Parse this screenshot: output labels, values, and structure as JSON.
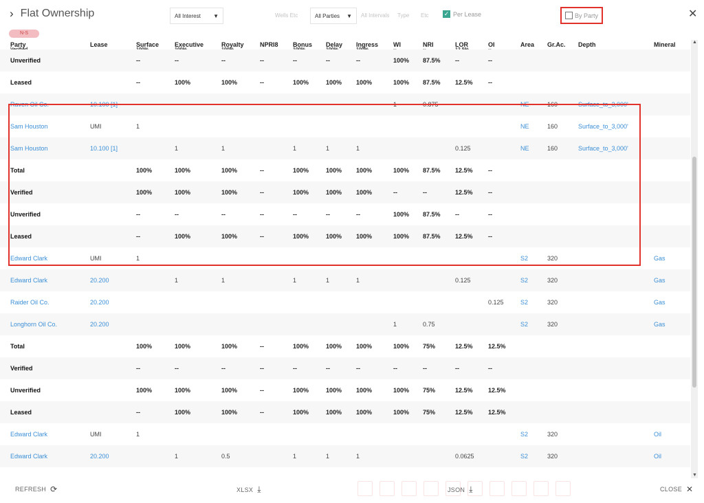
{
  "header": {
    "title": "Flat Ownership",
    "interest_select": "All Interest",
    "parties_select": "All Parties",
    "faded_filter_1": "Wells Etc",
    "faded_filter_2": "All Intervals",
    "faded_filter_3": "Type",
    "faded_filter_4": "Etc",
    "per_lease_label": "Per Lease",
    "per_lease_checked": true,
    "by_party_label": "By Party",
    "by_party_checked": false,
    "close_icon": "close-icon",
    "badge": "N-S"
  },
  "columns": [
    "Party",
    "Lease",
    "Surface",
    "Executive",
    "Royalty",
    "NPRI8",
    "Bonus",
    "Delay",
    "Ingress",
    "WI",
    "NRI",
    "LOR",
    "OI",
    "Area",
    "Gr.Ac.",
    "Depth",
    "Mineral"
  ],
  "partial_row": {
    "party": "Verified",
    "surface": "100%",
    "executive": "100%",
    "royalty": "100%",
    "bonus": "100%",
    "delay": "100%",
    "ingress": "100%",
    "wi": "--",
    "nri": "--",
    "lor": "12.5%",
    "oi": "--"
  },
  "rows": [
    {
      "type": "summary",
      "party": "Unverified",
      "surface": "--",
      "executive": "--",
      "royalty": "--",
      "npri8": "--",
      "bonus": "--",
      "delay": "--",
      "ingress": "--",
      "wi": "100%",
      "nri": "87.5%",
      "lor": "--",
      "oi": "--"
    },
    {
      "type": "summary",
      "party": "Leased",
      "surface": "--",
      "executive": "100%",
      "royalty": "100%",
      "npri8": "--",
      "bonus": "100%",
      "delay": "100%",
      "ingress": "100%",
      "wi": "100%",
      "nri": "87.5%",
      "lor": "12.5%",
      "oi": "--"
    },
    {
      "type": "party",
      "party": "Raven Oil Co.",
      "lease": "10.100 [1]",
      "lease_link": true,
      "wi": "1",
      "nri": "0.875",
      "area": "NE",
      "grac": "160",
      "depth": "Surface_to_3,000'"
    },
    {
      "type": "party",
      "party": "Sam Houston",
      "lease": "UMI",
      "surface": "1",
      "area": "NE",
      "grac": "160",
      "depth": "Surface_to_3,000'"
    },
    {
      "type": "party",
      "party": "Sam Houston",
      "lease": "10.100 [1]",
      "lease_link": true,
      "executive": "1",
      "royalty": "1",
      "bonus": "1",
      "delay": "1",
      "ingress": "1",
      "lor": "0.125",
      "area": "NE",
      "grac": "160",
      "depth": "Surface_to_3,000'"
    },
    {
      "type": "summary",
      "party": "Total",
      "surface": "100%",
      "executive": "100%",
      "royalty": "100%",
      "npri8": "--",
      "bonus": "100%",
      "delay": "100%",
      "ingress": "100%",
      "wi": "100%",
      "nri": "87.5%",
      "lor": "12.5%",
      "oi": "--"
    },
    {
      "type": "summary",
      "party": "Verified",
      "surface": "100%",
      "executive": "100%",
      "royalty": "100%",
      "npri8": "--",
      "bonus": "100%",
      "delay": "100%",
      "ingress": "100%",
      "wi": "--",
      "nri": "--",
      "lor": "12.5%",
      "oi": "--"
    },
    {
      "type": "summary",
      "party": "Unverified",
      "surface": "--",
      "executive": "--",
      "royalty": "--",
      "npri8": "--",
      "bonus": "--",
      "delay": "--",
      "ingress": "--",
      "wi": "100%",
      "nri": "87.5%",
      "lor": "--",
      "oi": "--"
    },
    {
      "type": "summary",
      "party": "Leased",
      "surface": "--",
      "executive": "100%",
      "royalty": "100%",
      "npri8": "--",
      "bonus": "100%",
      "delay": "100%",
      "ingress": "100%",
      "wi": "100%",
      "nri": "87.5%",
      "lor": "12.5%",
      "oi": "--"
    },
    {
      "type": "party",
      "party": "Edward Clark",
      "lease": "UMI",
      "surface": "1",
      "area": "S2",
      "grac": "320",
      "mineral": "Gas"
    },
    {
      "type": "party",
      "party": "Edward Clark",
      "lease": "20.200",
      "lease_link": true,
      "executive": "1",
      "royalty": "1",
      "bonus": "1",
      "delay": "1",
      "ingress": "1",
      "lor": "0.125",
      "area": "S2",
      "grac": "320",
      "mineral": "Gas"
    },
    {
      "type": "party",
      "party": "Raider Oil Co.",
      "lease": "20.200",
      "lease_link": true,
      "oi": "0.125",
      "area": "S2",
      "grac": "320",
      "mineral": "Gas"
    },
    {
      "type": "party",
      "party": "Longhorn Oil Co.",
      "lease": "20.200",
      "lease_link": true,
      "wi": "1",
      "nri": "0.75",
      "area": "S2",
      "grac": "320",
      "mineral": "Gas"
    },
    {
      "type": "summary",
      "party": "Total",
      "surface": "100%",
      "executive": "100%",
      "royalty": "100%",
      "npri8": "--",
      "bonus": "100%",
      "delay": "100%",
      "ingress": "100%",
      "wi": "100%",
      "nri": "75%",
      "lor": "12.5%",
      "oi": "12.5%"
    },
    {
      "type": "summary",
      "party": "Verified",
      "surface": "--",
      "executive": "--",
      "royalty": "--",
      "npri8": "--",
      "bonus": "--",
      "delay": "--",
      "ingress": "--",
      "wi": "--",
      "nri": "--",
      "lor": "--",
      "oi": "--"
    },
    {
      "type": "summary",
      "party": "Unverified",
      "surface": "100%",
      "executive": "100%",
      "royalty": "100%",
      "npri8": "--",
      "bonus": "100%",
      "delay": "100%",
      "ingress": "100%",
      "wi": "100%",
      "nri": "75%",
      "lor": "12.5%",
      "oi": "12.5%"
    },
    {
      "type": "summary",
      "party": "Leased",
      "surface": "--",
      "executive": "100%",
      "royalty": "100%",
      "npri8": "--",
      "bonus": "100%",
      "delay": "100%",
      "ingress": "100%",
      "wi": "100%",
      "nri": "75%",
      "lor": "12.5%",
      "oi": "12.5%"
    },
    {
      "type": "party",
      "party": "Edward Clark",
      "lease": "UMI",
      "surface": "1",
      "area": "S2",
      "grac": "320",
      "mineral": "Oil"
    },
    {
      "type": "party",
      "party": "Edward Clark",
      "lease": "20.200",
      "lease_link": true,
      "executive": "1",
      "royalty": "0.5",
      "bonus": "1",
      "delay": "1",
      "ingress": "1",
      "lor": "0.0625",
      "area": "S2",
      "grac": "320",
      "mineral": "Oil"
    }
  ],
  "footer": {
    "refresh_label": "REFRESH",
    "xlsx_label": "XLSX",
    "json_label": "JSON",
    "close_label": "CLOSE"
  },
  "colors": {
    "link": "#3b8fd6",
    "highlight": "#e0322b",
    "checkbox_accent": "#3aa590"
  }
}
